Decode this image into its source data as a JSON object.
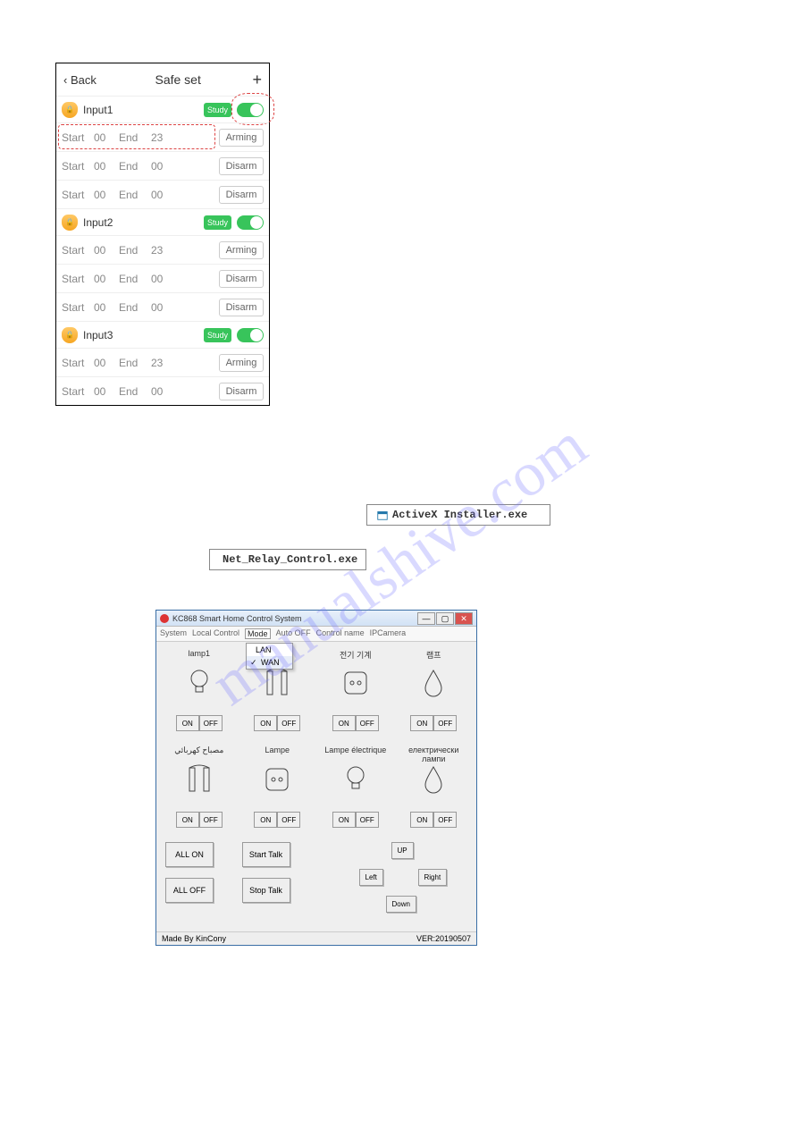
{
  "watermark": "manualshive.com",
  "phone": {
    "back": "Back",
    "title": "Safe set",
    "inputs": [
      {
        "label": "Input1",
        "study": "Study",
        "rows": [
          {
            "s": "Start",
            "sv": "00",
            "e": "End",
            "ev": "23",
            "btn": "Arming"
          },
          {
            "s": "Start",
            "sv": "00",
            "e": "End",
            "ev": "00",
            "btn": "Disarm"
          },
          {
            "s": "Start",
            "sv": "00",
            "e": "End",
            "ev": "00",
            "btn": "Disarm"
          }
        ]
      },
      {
        "label": "Input2",
        "study": "Study",
        "rows": [
          {
            "s": "Start",
            "sv": "00",
            "e": "End",
            "ev": "23",
            "btn": "Arming"
          },
          {
            "s": "Start",
            "sv": "00",
            "e": "End",
            "ev": "00",
            "btn": "Disarm"
          },
          {
            "s": "Start",
            "sv": "00",
            "e": "End",
            "ev": "00",
            "btn": "Disarm"
          }
        ]
      },
      {
        "label": "Input3",
        "study": "Study",
        "rows": [
          {
            "s": "Start",
            "sv": "00",
            "e": "End",
            "ev": "23",
            "btn": "Arming"
          },
          {
            "s": "Start",
            "sv": "00",
            "e": "End",
            "ev": "00",
            "btn": "Disarm"
          }
        ]
      }
    ]
  },
  "files": {
    "activex": "ActiveX Installer.exe",
    "netrelay": "Net_Relay_Control.exe"
  },
  "win": {
    "title": "KC868 Smart Home Control System",
    "menu": [
      "System",
      "Local Control",
      "Mode",
      "Auto OFF",
      "Control name",
      "IPCamera"
    ],
    "dropdown": [
      "LAN",
      "WAN"
    ],
    "devices_row1": [
      {
        "name": "lamp1",
        "icon": "bulb"
      },
      {
        "name": "",
        "icon": "gate"
      },
      {
        "name": "전기 기계",
        "icon": "socket"
      },
      {
        "name": "램프",
        "icon": "drop"
      }
    ],
    "devices_row2": [
      {
        "name": "مصباح كهربائي",
        "icon": "gate"
      },
      {
        "name": "Lampe",
        "icon": "socket"
      },
      {
        "name": "Lampe électrique",
        "icon": "bulb"
      },
      {
        "name": "електрически лампи",
        "icon": "drop"
      }
    ],
    "on": "ON",
    "off": "OFF",
    "allon": "ALL ON",
    "alloff": "ALL OFF",
    "starttalk": "Start Talk",
    "stoptalk": "Stop Talk",
    "up": "UP",
    "down": "Down",
    "left": "Left",
    "right": "Right",
    "madeby": "Made By KinCony",
    "ver": "VER:20190507"
  }
}
